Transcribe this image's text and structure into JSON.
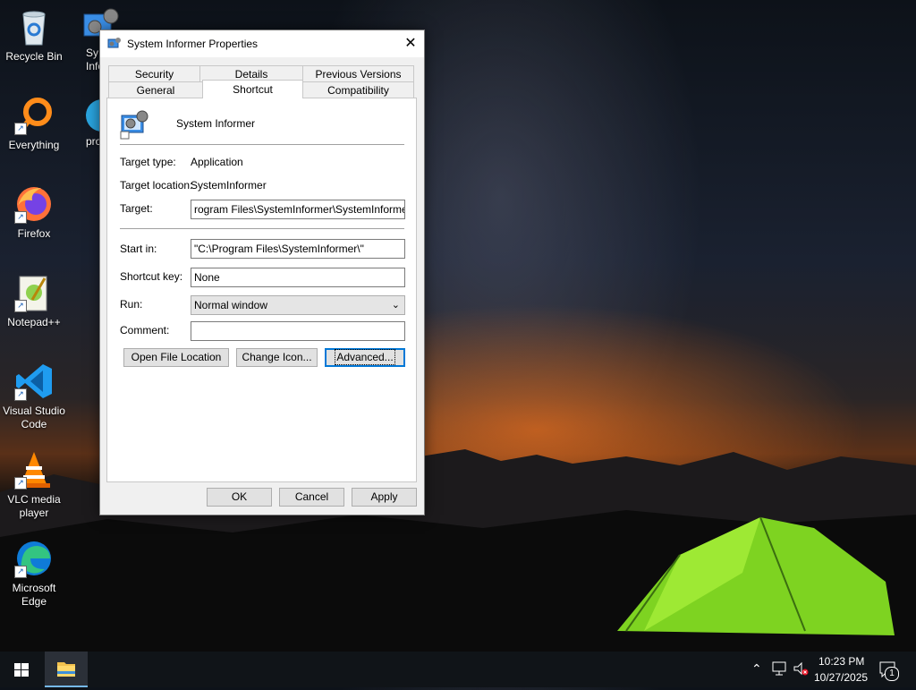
{
  "desktop": {
    "icons": [
      {
        "label": "Recycle Bin",
        "icon": "recycle-bin-icon"
      },
      {
        "label": "Everything",
        "icon": "everything-search-icon"
      },
      {
        "label": "Firefox",
        "icon": "firefox-icon"
      },
      {
        "label": "Notepad++",
        "icon": "notepad-plus-plus-icon"
      },
      {
        "label": "Visual Studio Code",
        "icon": "vscode-icon"
      },
      {
        "label": "VLC media player",
        "icon": "vlc-icon"
      },
      {
        "label": "Microsoft Edge",
        "icon": "edge-icon"
      },
      {
        "label": "Sy\nInfo",
        "icon": "system-informer-icon"
      },
      {
        "label": "pro",
        "icon": "process-icon"
      }
    ]
  },
  "dialog": {
    "title": "System Informer Properties",
    "tabs_row1": [
      "Security",
      "Details",
      "Previous Versions"
    ],
    "tabs_row2": [
      "General",
      "Shortcut",
      "Compatibility"
    ],
    "active_tab": "Shortcut",
    "app_name": "System Informer",
    "target_type_label": "Target type:",
    "target_type_value": "Application",
    "target_location_label": "Target location:",
    "target_location_value": "SystemInformer",
    "target_label": "Target:",
    "target_value": "rogram Files\\SystemInformer\\SystemInformer.exe\"",
    "start_in_label": "Start in:",
    "start_in_value": "\"C:\\Program Files\\SystemInformer\\\"",
    "shortcut_key_label": "Shortcut key:",
    "shortcut_key_value": "None",
    "run_label": "Run:",
    "run_value": "Normal window",
    "comment_label": "Comment:",
    "comment_value": "",
    "buttons": {
      "open_file_location": "Open File Location",
      "change_icon": "Change Icon...",
      "advanced": "Advanced...",
      "ok": "OK",
      "cancel": "Cancel",
      "apply": "Apply"
    }
  },
  "taskbar": {
    "time": "10:23 PM",
    "date": "10/27/2025",
    "notification_count": "1"
  },
  "colors": {
    "accent": "#0078d7",
    "taskbar": "#101418",
    "dialog_bg": "#f0f0f0"
  }
}
